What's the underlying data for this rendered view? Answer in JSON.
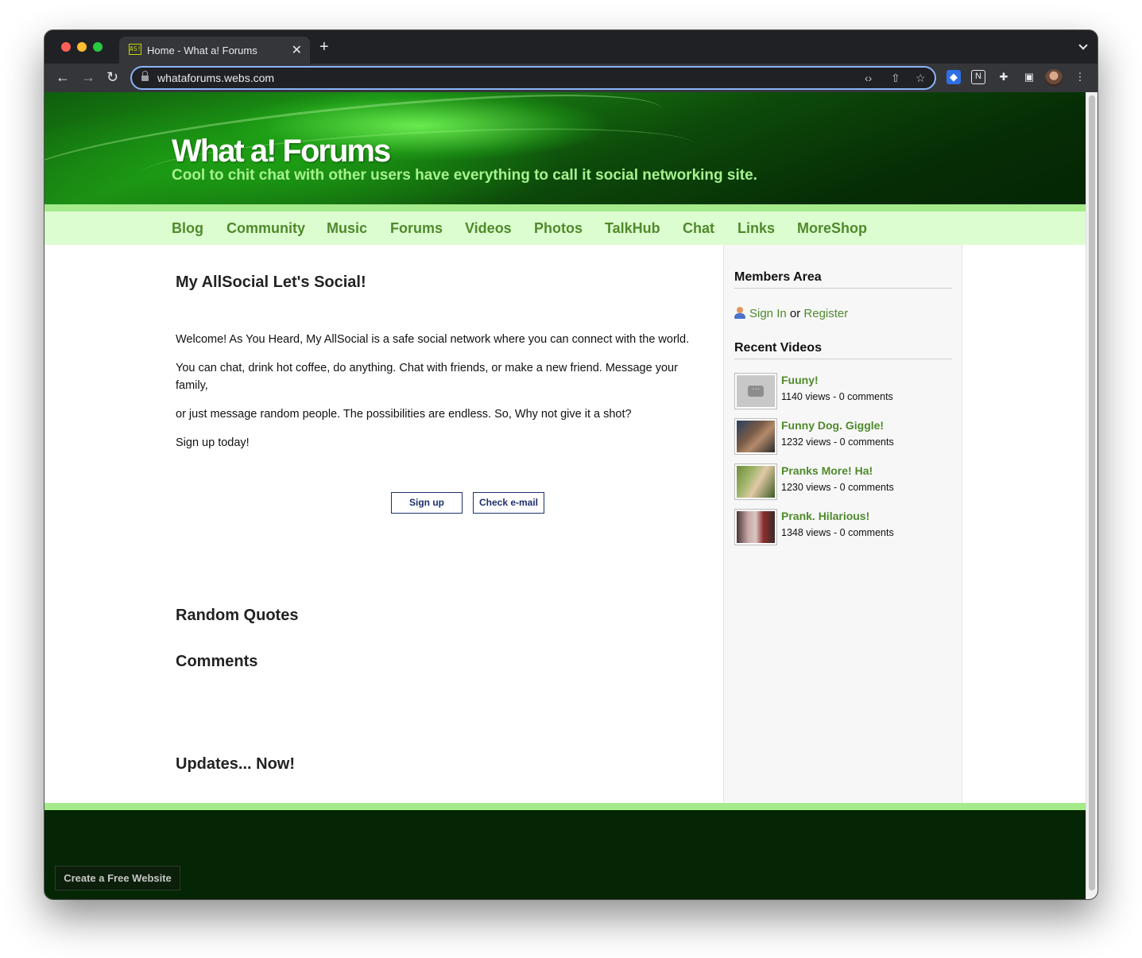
{
  "browser": {
    "tab_title": "Home - What a! Forums",
    "tab_favicon_text": "AS!",
    "url": "whataforums.webs.com"
  },
  "site": {
    "title": "What a! Forums",
    "tagline": "Cool to chit chat with other users have everything to call it social networking site."
  },
  "nav": {
    "items": [
      "Blog",
      "Community",
      "Music",
      "Forums",
      "Videos",
      "Photos",
      "TalkHub",
      "Chat",
      "Links",
      "MoreShop"
    ]
  },
  "main": {
    "title": "My AllSocial Let's Social!",
    "paragraphs": [
      "Welcome! As You Heard, My AllSocial is a safe social network where you can connect with the world.",
      "You can chat, drink hot coffee, do anything. Chat with friends, or make a new friend. Message your family,",
      "or just message random people. The possibilities are endless. So, Why not give it a shot?",
      "Sign up today!"
    ],
    "signup_label": "Sign up",
    "check_email_label": "Check e-mail",
    "random_quotes_heading": "Random Quotes",
    "comments_heading": "Comments",
    "updates_heading": "Updates... Now!"
  },
  "sidebar": {
    "members_heading": "Members Area",
    "sign_in": "Sign In",
    "or": "or",
    "register": "Register",
    "videos_heading": "Recent Videos",
    "videos": [
      {
        "title": "Fuuny!",
        "meta": "1140 views - 0 comments"
      },
      {
        "title": "Funny Dog. Giggle!",
        "meta": "1232 views - 0 comments"
      },
      {
        "title": "Pranks More! Ha!",
        "meta": "1230 views - 0 comments"
      },
      {
        "title": "Prank. Hilarious!",
        "meta": "1348 views - 0 comments"
      }
    ]
  },
  "footer": {
    "create_label": "Create a Free Website"
  },
  "colors": {
    "nav_link": "#4f8a2b",
    "nav_bg": "#dcfdd0",
    "accent_line": "#a5eb8b",
    "footer_bg": "#052604"
  }
}
